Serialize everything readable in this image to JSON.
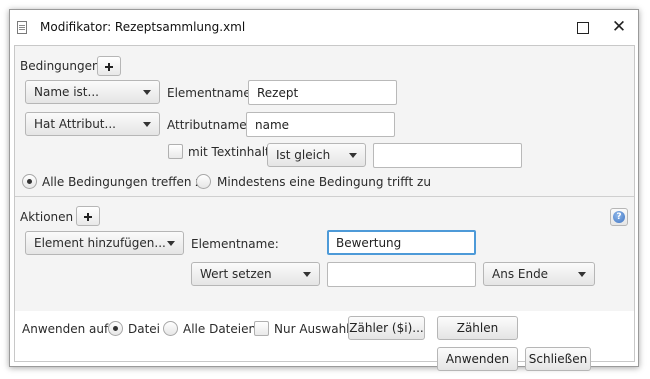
{
  "window": {
    "title": "Modifikator: Rezeptsammlung.xml"
  },
  "conditions": {
    "section_label": "Bedingungen",
    "row1": {
      "combo": "Name ist...",
      "field_label": "Elementname:",
      "field_value": "Rezept"
    },
    "row2": {
      "combo": "Hat Attribut...",
      "field_label": "Attributname:",
      "field_value": "name"
    },
    "row3": {
      "checkbox_label": "mit Textinhalt",
      "checkbox_checked": false,
      "combo": "Ist gleich",
      "field_value": ""
    },
    "match_options": [
      {
        "label": "Alle Bedingungen treffen zu",
        "selected": true
      },
      {
        "label": "Mindestens eine Bedingung trifft zu",
        "selected": false
      }
    ]
  },
  "actions": {
    "section_label": "Aktionen",
    "row1": {
      "combo": "Element hinzufügen...",
      "field_label": "Elementname:",
      "field_value": "Bewertung"
    },
    "row2": {
      "combo": "Wert setzen",
      "field_value": "",
      "position_combo": "Ans Ende"
    }
  },
  "footer": {
    "apply_label": "Anwenden auf:",
    "apply_options": [
      {
        "label": "Datei",
        "selected": true
      },
      {
        "label": "Alle Dateien",
        "selected": false
      }
    ],
    "selection_only_label": "Nur Auswahl",
    "selection_only_checked": false,
    "counter_button": "Zähler ($i)...",
    "count_button": "Zählen",
    "apply_button": "Anwenden",
    "close_button": "Schließen"
  },
  "colors": {
    "focus_border": "#4d9ad8",
    "panel_background": "#f4f4f4"
  },
  "icons": [
    "document-icon",
    "maximize-icon",
    "close-icon",
    "add-icon",
    "help-icon",
    "chevron-down-icon"
  ]
}
